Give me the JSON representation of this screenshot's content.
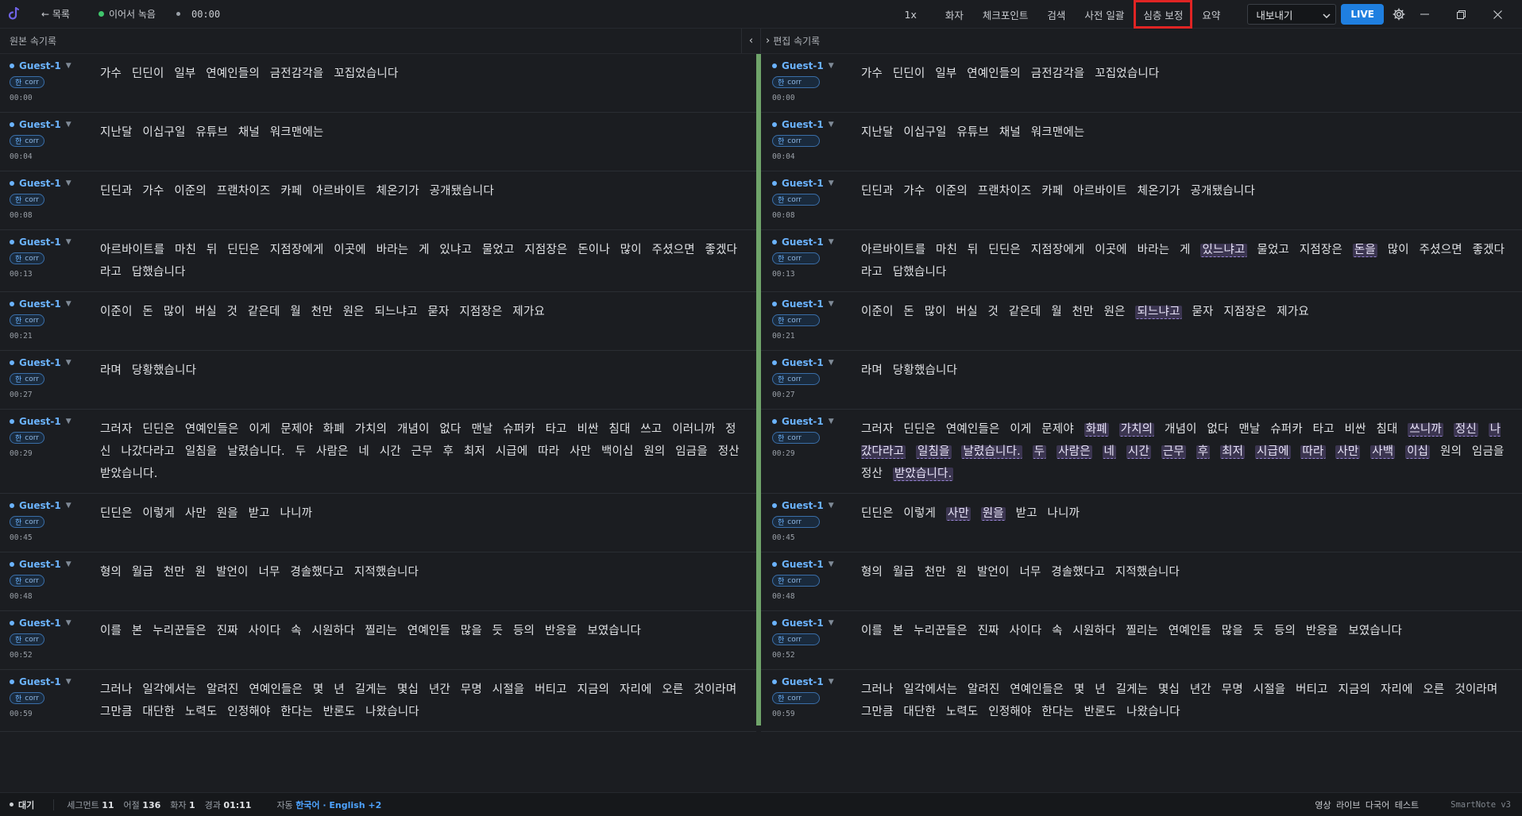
{
  "topbar": {
    "back_label": "← 목록",
    "record_label": "이어서 녹음",
    "timer": "00:00",
    "speed": "1x",
    "menu": [
      "화자",
      "체크포인트",
      "검색",
      "사전 일괄",
      "심층 보정",
      "요약"
    ],
    "highlighted_index": 4,
    "export_label": "내보내기",
    "live_label": "LIVE"
  },
  "panels": {
    "left_title": "원본 속기록",
    "right_title": "편집 속기록"
  },
  "badge": {
    "lang": "한",
    "corr": "corr"
  },
  "segments": [
    {
      "speaker": "Guest-1",
      "time": "00:00",
      "left": "가수 딘딘이 일부 연예인들의 금전감각을 꼬집었습니다",
      "right": [
        [
          "가수 딘딘이 일부 연예인들의 금전감각을 꼬집었습니다",
          false
        ]
      ]
    },
    {
      "speaker": "Guest-1",
      "time": "00:04",
      "left": "지난달 이십구일 유튜브 채널 워크맨에는",
      "right": [
        [
          "지난달 이십구일 유튜브 채널 워크맨에는",
          false
        ]
      ]
    },
    {
      "speaker": "Guest-1",
      "time": "00:08",
      "left": "딘딘과 가수 이준의 프랜차이즈 카페 아르바이트 체온기가 공개됐습니다",
      "right": [
        [
          "딘딘과 가수 이준의 프랜차이즈 카페 아르바이트 체온기가 공개됐습니다",
          false
        ]
      ]
    },
    {
      "speaker": "Guest-1",
      "time": "00:13",
      "left": "아르바이트를 마친 뒤 딘딘은 지점장에게 이곳에 바라는 게 있냐고 물었고 지점장은 돈이나 많이 주셨으면 좋겠다라고 답했습니다",
      "right": [
        [
          "아르바이트를 마친 뒤 딘딘은 지점장에게 이곳에 바라는 게 ",
          false
        ],
        [
          "있느냐고",
          true
        ],
        [
          " 물었고 지점장은 ",
          false
        ],
        [
          "돈을",
          true
        ],
        [
          " 많이 주셨으면 좋겠다라고 답했습니다",
          false
        ]
      ]
    },
    {
      "speaker": "Guest-1",
      "time": "00:21",
      "left": "이준이 돈 많이 버실 것 같은데 월 천만 원은 되느냐고 묻자 지점장은 제가요",
      "right": [
        [
          "이준이 돈 많이 버실 것 같은데 월 천만 원은 ",
          false
        ],
        [
          "되느냐고",
          true
        ],
        [
          " 묻자 지점장은 제가요",
          false
        ]
      ]
    },
    {
      "speaker": "Guest-1",
      "time": "00:27",
      "left": "라며 당황했습니다",
      "right": [
        [
          "라며 당황했습니다",
          false
        ]
      ]
    },
    {
      "speaker": "Guest-1",
      "time": "00:29",
      "left": "그러자 딘딘은 연예인들은 이게 문제야 화폐 가치의 개념이 없다 맨날 슈퍼카 타고 비싼 침대 쓰고 이러니까 정신 나갔다라고 일침을 날렸습니다. 두 사람은 네 시간 근무 후 최저 시급에 따라 사만 백이십 원의 임금을 정산 받았습니다.",
      "right": [
        [
          "그러자 딘딘은 연예인들은 이게 문제야 ",
          false
        ],
        [
          "화폐",
          true
        ],
        [
          " ",
          false
        ],
        [
          "가치의",
          true
        ],
        [
          " 개념이 없다 맨날 슈퍼카 타고 비싼 침대 ",
          false
        ],
        [
          "쓰니까",
          true
        ],
        [
          " ",
          false
        ],
        [
          "정신",
          true
        ],
        [
          " ",
          false
        ],
        [
          "나갔다라고",
          true
        ],
        [
          " ",
          false
        ],
        [
          "일침을",
          true
        ],
        [
          " ",
          false
        ],
        [
          "날렸습니다.",
          true
        ],
        [
          " ",
          false
        ],
        [
          "두",
          true
        ],
        [
          " ",
          false
        ],
        [
          "사람은",
          true
        ],
        [
          " ",
          false
        ],
        [
          "네",
          true
        ],
        [
          " ",
          false
        ],
        [
          "시간",
          true
        ],
        [
          " ",
          false
        ],
        [
          "근무",
          true
        ],
        [
          " ",
          false
        ],
        [
          "후",
          true
        ],
        [
          " ",
          false
        ],
        [
          "최저",
          true
        ],
        [
          " ",
          false
        ],
        [
          "시급에",
          true
        ],
        [
          " ",
          false
        ],
        [
          "따라",
          true
        ],
        [
          " ",
          false
        ],
        [
          "사만",
          true
        ],
        [
          " ",
          false
        ],
        [
          "사백",
          true
        ],
        [
          " ",
          false
        ],
        [
          "이십",
          true
        ],
        [
          " 원의 임금을 정산 ",
          false
        ],
        [
          "받았습니다.",
          true
        ]
      ]
    },
    {
      "speaker": "Guest-1",
      "time": "00:45",
      "left": "딘딘은 이렇게 사만 원을 받고 나니까",
      "right": [
        [
          "딘딘은 이렇게 ",
          false
        ],
        [
          "사만",
          true
        ],
        [
          " ",
          false
        ],
        [
          "원을",
          true
        ],
        [
          " 받고 나니까",
          false
        ]
      ]
    },
    {
      "speaker": "Guest-1",
      "time": "00:48",
      "left": "형의 월급 천만 원 발언이 너무 경솔했다고 지적했습니다",
      "right": [
        [
          "형의 월급 천만 원 발언이 너무 경솔했다고 지적했습니다",
          false
        ]
      ]
    },
    {
      "speaker": "Guest-1",
      "time": "00:52",
      "left": "이를 본 누리꾼들은 진짜 사이다 속 시원하다 찔리는 연예인들 많을 듯 등의 반응을 보였습니다",
      "right": [
        [
          "이를 본 누리꾼들은 진짜 사이다 속 시원하다 찔리는 연예인들 많을 듯 등의 반응을 보였습니다",
          false
        ]
      ]
    },
    {
      "speaker": "Guest-1",
      "time": "00:59",
      "left": "그러나 일각에서는 알려진 연예인들은 몇 년 길게는 몇십 년간 무명 시절을 버티고 지금의 자리에 오른 것이라며 그만큼 대단한 노력도 인정해야 한다는 반론도 나왔습니다",
      "right": [
        [
          "그러나 일각에서는 알려진 연예인들은 몇 년 길게는 몇십 년간 무명 시절을 버티고 지금의 자리에 오른 것이라며 그만큼 대단한 노력도 인정해야 한다는 반론도 나왔습니다",
          false
        ]
      ]
    }
  ],
  "statusbar": {
    "state": "대기",
    "segments_label": "세그먼트",
    "segments_value": "11",
    "words_label": "어절",
    "words_value": "136",
    "speakers_label": "화자",
    "speakers_value": "1",
    "elapsed_label": "경과",
    "elapsed_value": "01:11",
    "lang_prefix": "자동",
    "lang_value": "한국어 · English +2",
    "title": "영상 라이브 다국어 테스트",
    "brand": "SmartNote v3"
  },
  "colors": {
    "accent": "#1f7fe0",
    "speaker": "#6bb3ff",
    "divider": "#6fa46a",
    "highlight_bg": "#3b3550",
    "highlight_border": "#e02424"
  },
  "icons": [
    "app-logo-icon",
    "arrow-left-icon",
    "record-dot-icon",
    "gear-icon",
    "minimize-icon",
    "maximize-icon",
    "close-icon",
    "chevron-left-icon",
    "chevron-right-icon",
    "caret-down-icon"
  ]
}
